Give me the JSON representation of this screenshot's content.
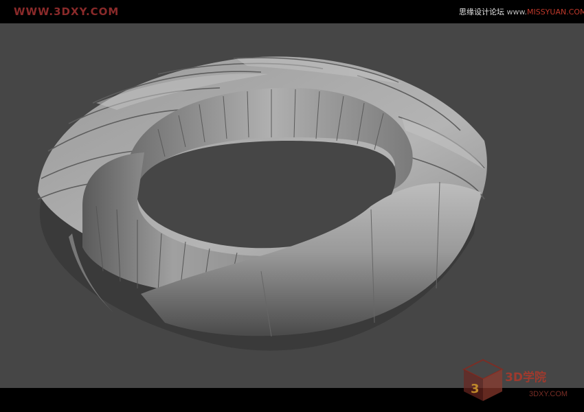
{
  "watermark": {
    "site_left": "WWW.3DXY.COM",
    "forum_cn": "思缘设计论坛",
    "separator": "www.",
    "site_right": "MISSYUAN.COM",
    "logo_text": "3D学院",
    "logo_sub": "3DXY.COM"
  },
  "colors": {
    "background": "#464646",
    "bars": "#000000",
    "model": "#8c8c8c",
    "watermark_red": "#9e3a2e"
  },
  "scene": {
    "subject": "torus-ring-with-overlapping-fins-3d-model"
  }
}
